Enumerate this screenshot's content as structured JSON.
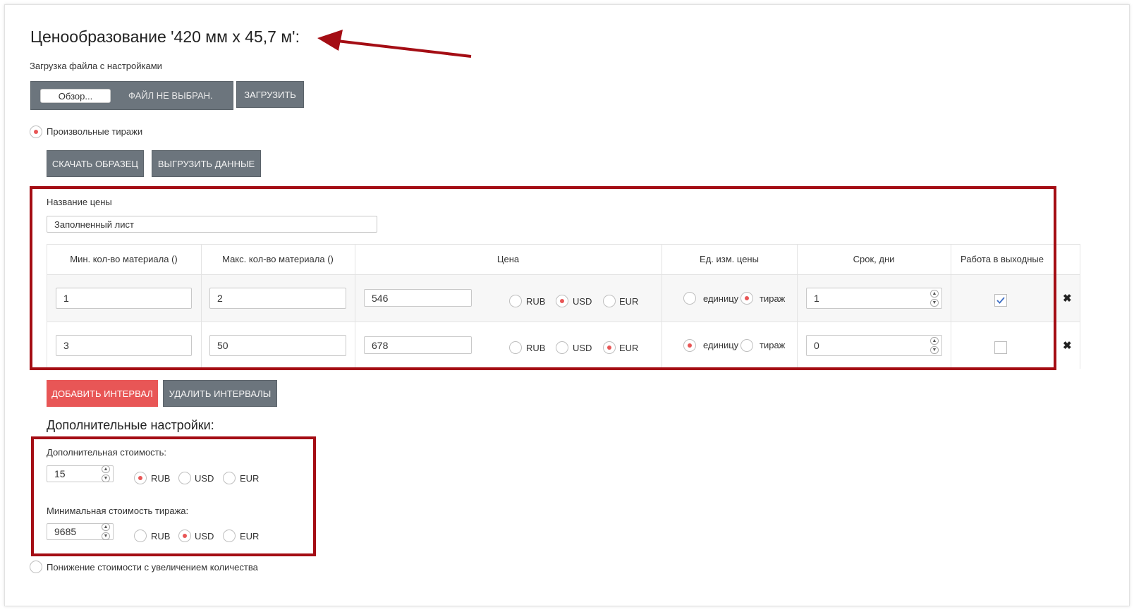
{
  "page": {
    "title": "Ценообразование '420 мм х 45,7 м':",
    "upload_label": "Загрузка файла с настройками",
    "browse_label": "Обзор...",
    "no_file_label": "ФАЙЛ НЕ ВЫБРАН.",
    "upload_button": "ЗАГРУЗИТЬ",
    "custom_runs_label": "Произвольные тиражи",
    "download_sample_button": "СКАЧАТЬ ОБРАЗЕЦ",
    "export_data_button": "ВЫГРУЗИТЬ ДАННЫЕ"
  },
  "price": {
    "name_label": "Название цены",
    "name_value": "Заполненный лист",
    "headers": [
      "Мин. кол-во материала ()",
      "Макс. кол-во материала ()",
      "Цена",
      "Ед. изм. цены",
      "Срок, дни",
      "Работа в выходные"
    ],
    "currency_options": [
      "RUB",
      "USD",
      "EUR"
    ],
    "unit_options": [
      "единицу",
      "тираж"
    ],
    "rows": [
      {
        "min": "1",
        "max": "2",
        "price": "546",
        "currency": "USD",
        "unit": "тираж",
        "days": "1",
        "weekend": true
      },
      {
        "min": "3",
        "max": "50",
        "price": "678",
        "currency": "EUR",
        "unit": "единицу",
        "days": "0",
        "weekend": false
      }
    ],
    "add_interval_button": "ДОБАВИТЬ ИНТЕРВАЛ",
    "delete_intervals_button": "УДАЛИТЬ ИНТЕРВАЛЫ"
  },
  "extra": {
    "title": "Дополнительные настройки:",
    "additional_cost_label": "Дополнительная стоимость:",
    "additional_cost_value": "15",
    "additional_cost_currency": "RUB",
    "min_cost_label": "Минимальная стоимость тиража:",
    "min_cost_value": "9685",
    "min_cost_currency": "USD",
    "discount_label": "Понижение стоимости с увеличением количества"
  },
  "colors": {
    "annotation_red": "#a40d14",
    "accent_red": "#e85656",
    "button_gray": "#6c757d"
  },
  "icons": {
    "arrow": "annotation-arrow-icon",
    "remove": "close-icon",
    "check": "checkmark-icon"
  }
}
